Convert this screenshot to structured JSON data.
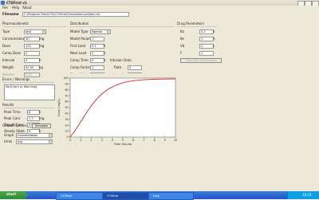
{
  "window": {
    "title": "CTSFirst v1"
  },
  "menu": [
    "File",
    "Help",
    "About"
  ],
  "filename": {
    "label": "Filename",
    "value": "C:\\Program Files\\CTS\\CTSFirst\\Simulation\\untitled.cts"
  },
  "groups": {
    "pharmacokinetic": "Pharmacokinetic",
    "distribution": "Distribution",
    "drug": "Drug Parameters",
    "infusion": "Infusion Data",
    "errors": "Errors / Warnings",
    "results": "Results",
    "output": "Output Options"
  },
  "left_fields": [
    {
      "label": "Type",
      "value": "oral"
    },
    {
      "label": "Concentration",
      "value": "30"
    },
    {
      "label": "Dose",
      "value": "125"
    },
    {
      "label": "Comp Dose",
      "value": "0"
    },
    {
      "label": "Interval",
      "value": "0"
    },
    {
      "label": "Weight",
      "value": "50.00"
    },
    {
      "label": "Volume",
      "value": "2.31"
    }
  ],
  "left_units": [
    "",
    "mg",
    "mg",
    "",
    "h",
    "kg",
    "L"
  ],
  "mid_fields": [
    {
      "label": "Model Type",
      "value": "Normal"
    },
    {
      "label": "Model Param",
      "value": "1"
    },
    {
      "label": "First Load",
      "value": "0.1"
    },
    {
      "label": "Next Load",
      "value": "0"
    },
    {
      "label": "Comp Time",
      "value": "0"
    },
    {
      "label": "Comp Factor",
      "value": "1"
    },
    {
      "label": "Comp Value",
      "value": "1"
    }
  ],
  "mid_units": [
    "",
    "",
    "h",
    "h",
    "h",
    "",
    ""
  ],
  "infusion_fields": [
    {
      "label": "Rate",
      "value": "0"
    },
    {
      "label": "Length",
      "value": "0"
    }
  ],
  "right_fields": [
    {
      "label": "Ka",
      "value": "0.5"
    },
    {
      "label": "Ke",
      "value": "1"
    },
    {
      "label": "Vd",
      "value": "2"
    },
    {
      "label": "F",
      "value": "1"
    }
  ],
  "right_units": [
    "h",
    "h",
    "L",
    ""
  ],
  "disabled_button": "Calculate Parameters",
  "messages": "No Errors or Warnings",
  "results": [
    {
      "label": "Peak Time",
      "value": "8",
      "unit": "h"
    },
    {
      "label": "Peak Conc",
      "value": "7.7",
      "unit": "mg"
    },
    {
      "label": "Trough Conc",
      "value": "0.0",
      "unit": "mg"
    },
    {
      "label": "Steady State",
      "value": "9",
      "unit": "h"
    }
  ],
  "output_button": "Simulate",
  "output_fields": [
    {
      "label": "Graph",
      "value": "Concentration"
    },
    {
      "label": "Units",
      "value": "mg"
    }
  ],
  "taskbar": {
    "start": "start",
    "items": [
      "CTSFirst",
      "CTSFirst",
      "Help"
    ],
    "clock": "10:23"
  },
  "colors": {
    "curve": "#e02020",
    "desktop_blue": "#2257c6",
    "window_bg": "#ece9d8"
  },
  "chart_data": {
    "type": "line",
    "title": "",
    "xlabel": "Time (hours)",
    "ylabel": "Conc (mg/L)",
    "xlim": [
      0,
      10
    ],
    "ylim": [
      0,
      100
    ],
    "xticks": [
      "0",
      "1",
      "2",
      "3",
      "4",
      "5",
      "6",
      "7",
      "8",
      "9",
      "10"
    ],
    "yticks": [
      "0",
      "10",
      "20",
      "30",
      "40",
      "50",
      "60",
      "70",
      "80",
      "90",
      "100"
    ],
    "grid": false,
    "series": [
      {
        "color": "#e02020",
        "x": [
          0,
          0.5,
          1,
          1.5,
          2,
          2.5,
          3,
          3.5,
          4,
          4.5,
          5,
          5.5,
          6,
          6.5,
          7,
          7.5,
          8,
          8.5,
          9,
          9.5,
          10
        ],
        "y": [
          0,
          12,
          26,
          40,
          53,
          64,
          73,
          80,
          85,
          89,
          92,
          94,
          95.5,
          96.5,
          97.2,
          97.7,
          98,
          98.2,
          98.4,
          98.5,
          98.6
        ]
      }
    ]
  }
}
